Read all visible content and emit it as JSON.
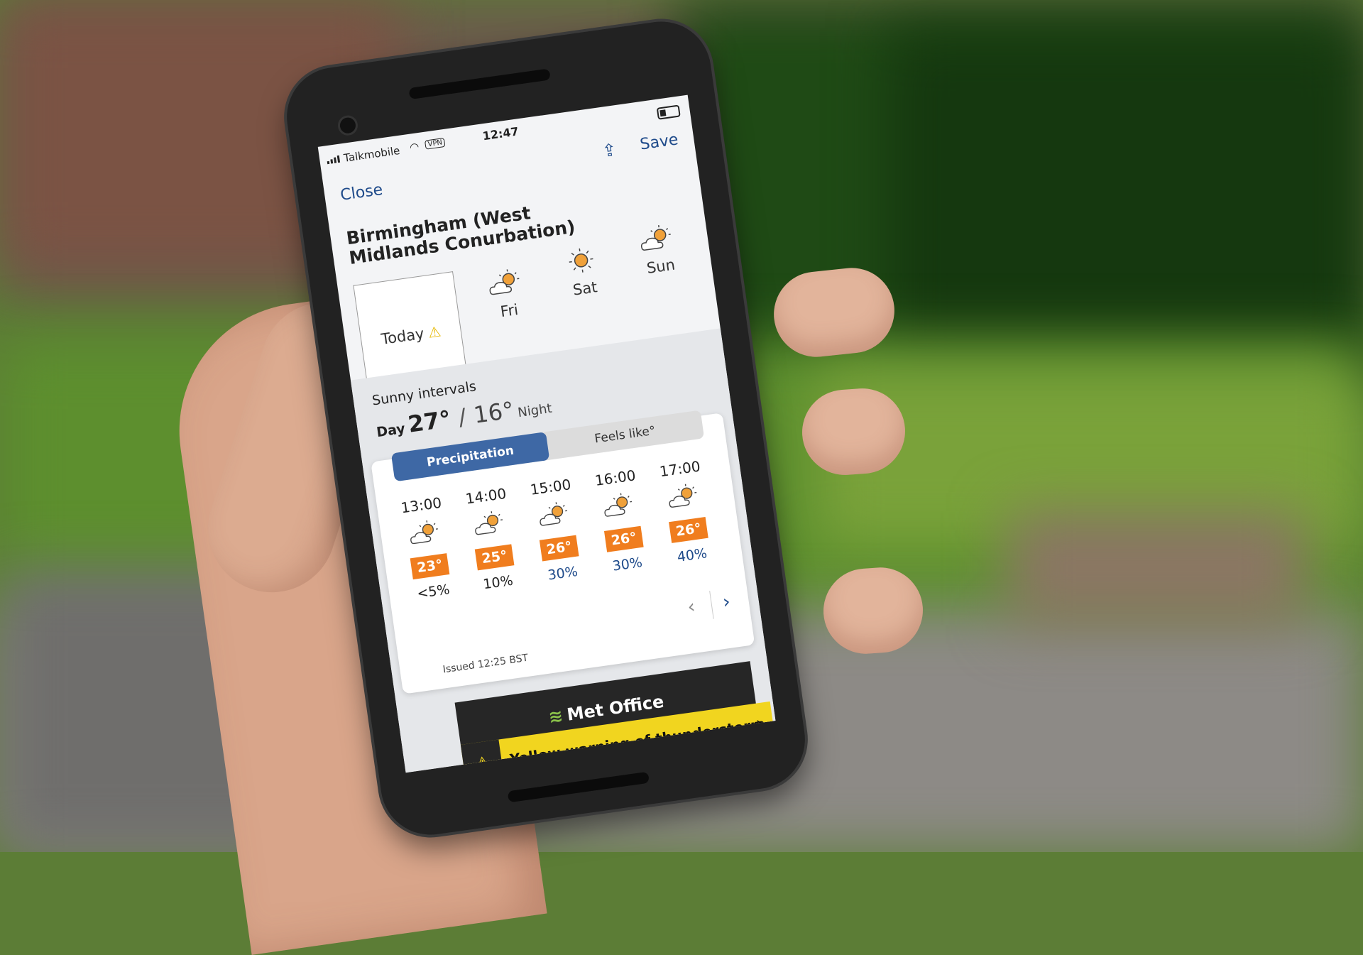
{
  "status_bar": {
    "carrier": "Talkmobile",
    "vpn": "VPN",
    "time": "12:47"
  },
  "nav": {
    "save_label": "Save",
    "close_label": "Close"
  },
  "location": "Birmingham (West Midlands Conurbation)",
  "day_tabs": [
    {
      "label": "Today",
      "icon": "warning-icon",
      "active": true
    },
    {
      "label": "Fri",
      "icon": "sunny-intervals-icon"
    },
    {
      "label": "Sat",
      "icon": "sun-icon"
    },
    {
      "label": "Sun",
      "icon": "sunny-intervals-icon"
    }
  ],
  "summary": {
    "condition": "Sunny intervals",
    "day_label": "Day",
    "day_temp": "27°",
    "night_temp": "16°",
    "night_label": "Night"
  },
  "toggle": {
    "precipitation": "Precipitation",
    "feels_like": "Feels like°"
  },
  "hourly": [
    {
      "time": "13:00",
      "temp": "23°",
      "precip": "<5%",
      "icon": "sunny-intervals-icon"
    },
    {
      "time": "14:00",
      "temp": "25°",
      "precip": "10%",
      "icon": "sunny-intervals-icon"
    },
    {
      "time": "15:00",
      "temp": "26°",
      "precip": "30%",
      "icon": "sunny-intervals-icon"
    },
    {
      "time": "16:00",
      "temp": "26°",
      "precip": "30%",
      "icon": "sunny-intervals-icon"
    },
    {
      "time": "17:00",
      "temp": "26°",
      "precip": "40%",
      "icon": "sunny-intervals-icon"
    }
  ],
  "issued": "Issued 12:25 BST",
  "met_office": "Met Office",
  "warning_banner": "Yellow warning of thunderstorm",
  "colors": {
    "accent": "#3e68a5",
    "temp_badge": "#f07d1e",
    "warning_yellow": "#f1d51f",
    "link": "#1e4a8a"
  }
}
